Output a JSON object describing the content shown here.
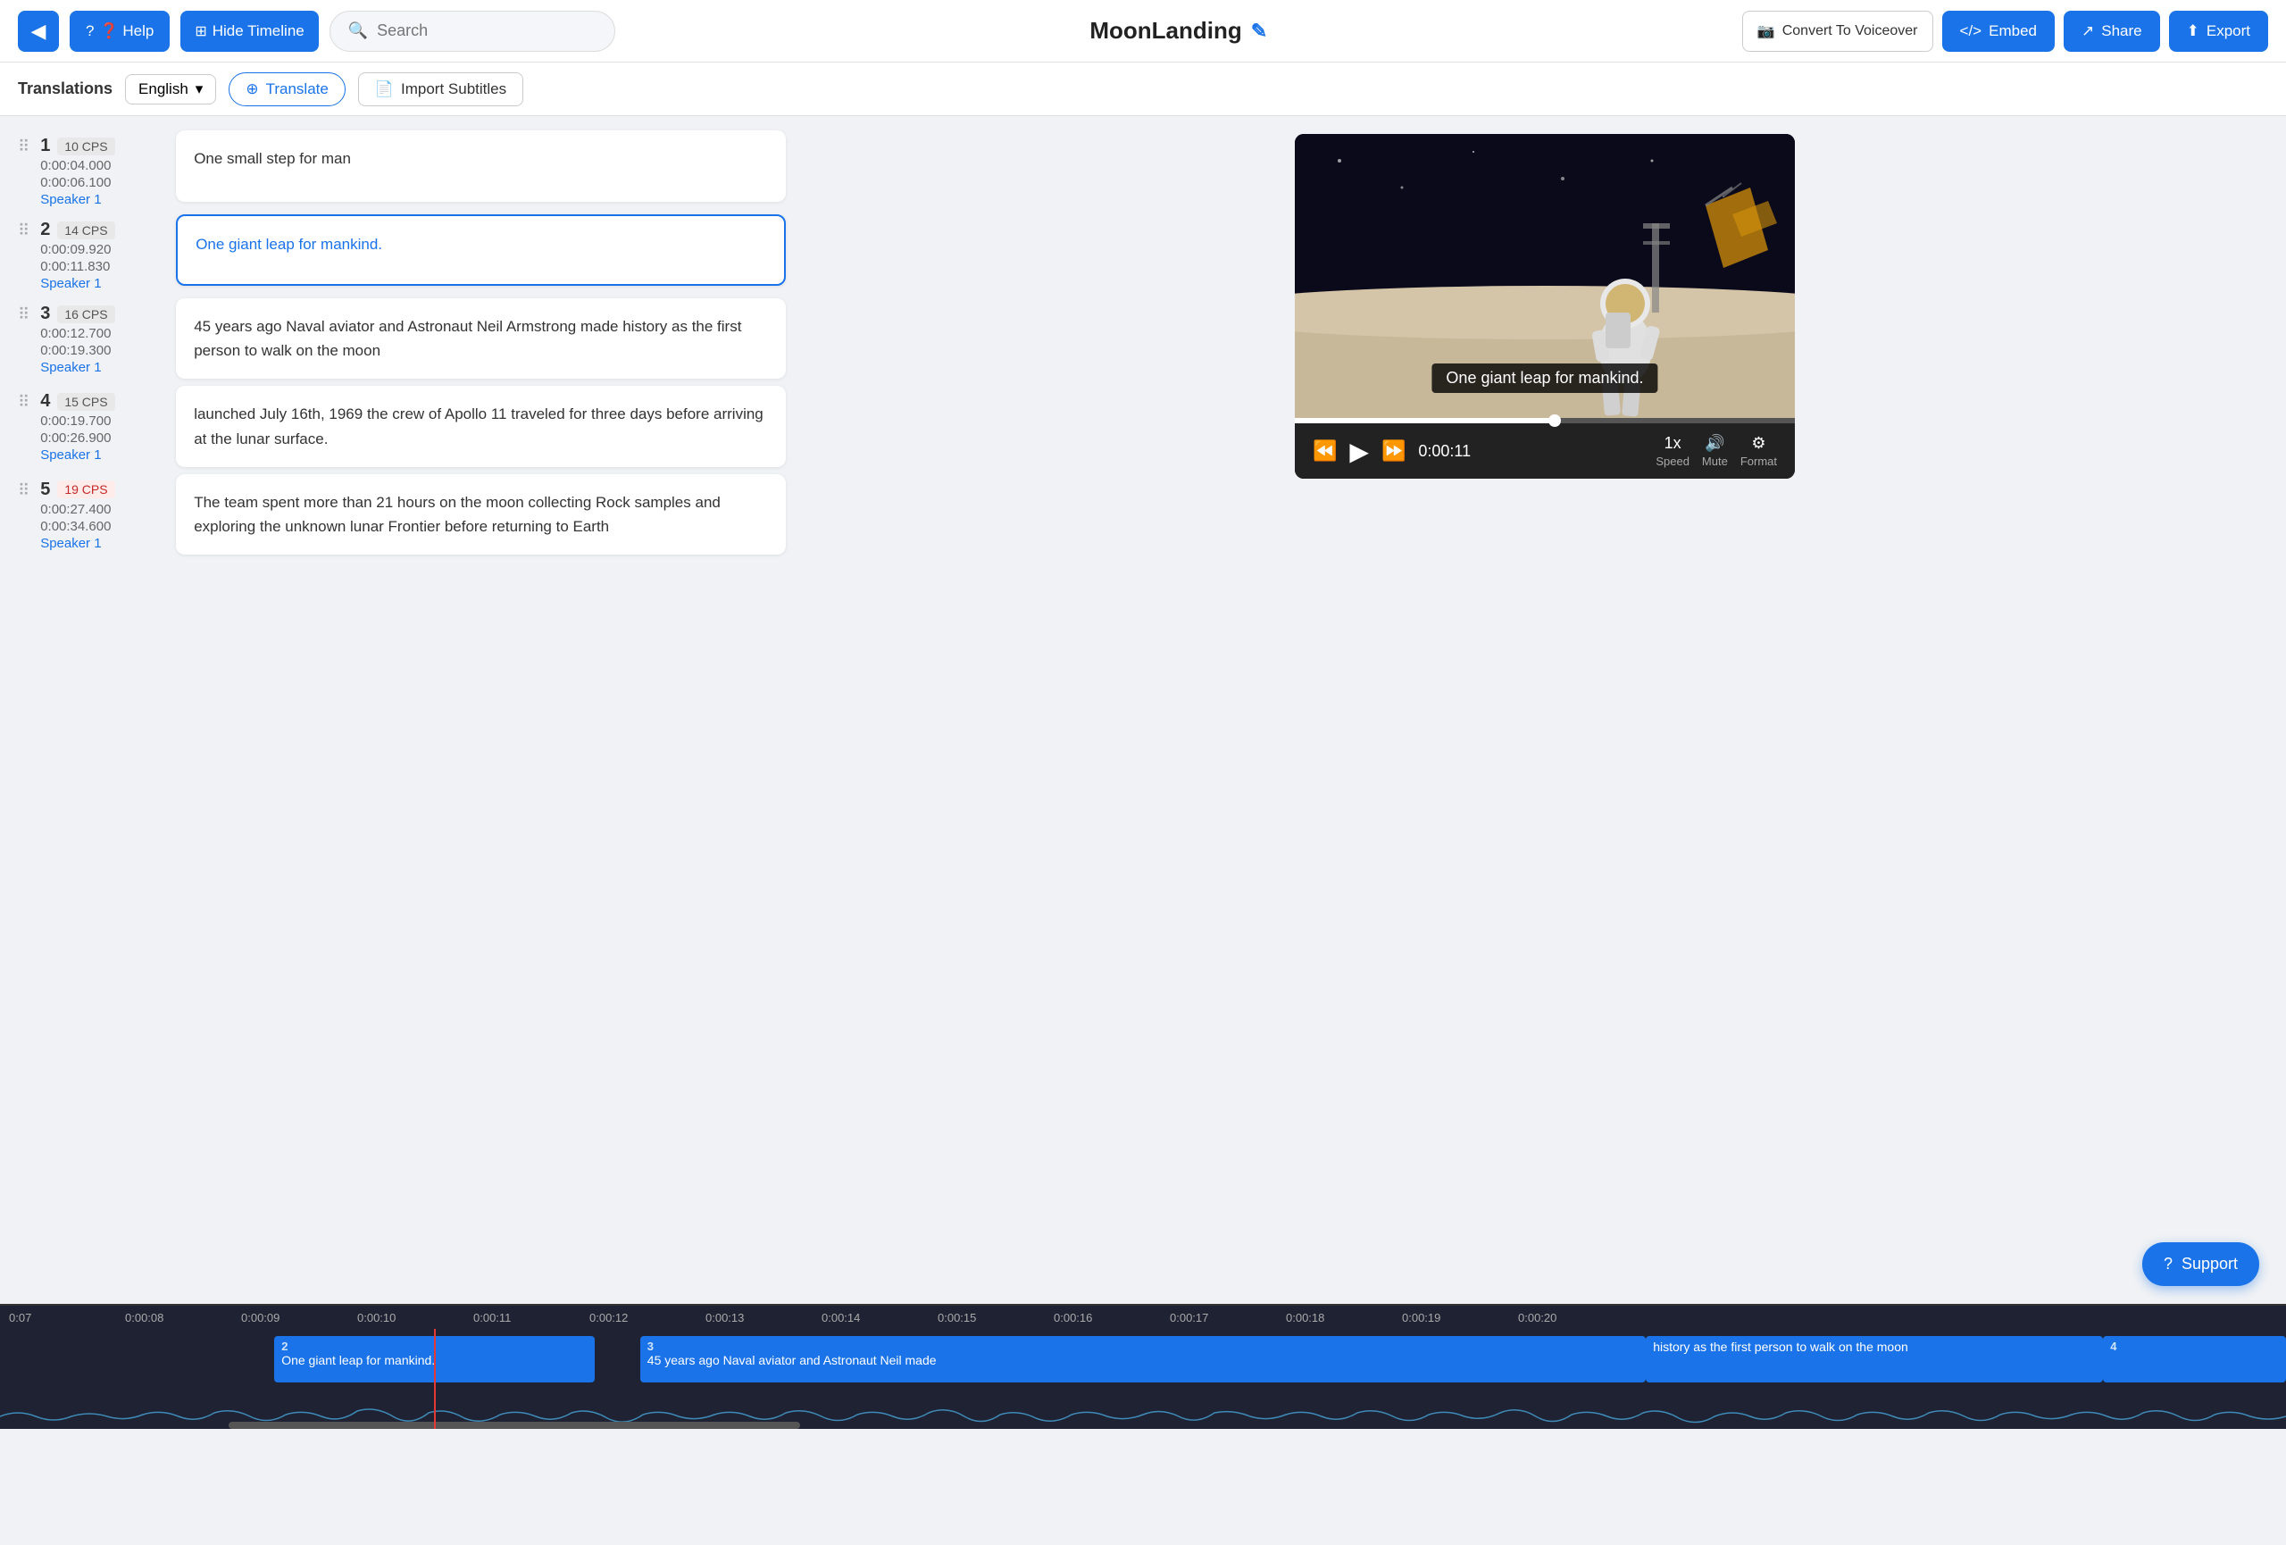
{
  "navbar": {
    "back_icon": "◀",
    "help_label": "❓ Help",
    "hide_timeline_label": "Hide Timeline",
    "search_placeholder": "Search",
    "title": "MoonLanding",
    "edit_icon": "✎",
    "convert_label": "Convert To Voiceover",
    "embed_label": "Embed",
    "share_label": "Share",
    "export_label": "Export"
  },
  "subtitle_toolbar": {
    "label": "Translations",
    "language": "English",
    "translate_label": "Translate",
    "import_label": "Import Subtitles"
  },
  "subtitles": [
    {
      "num": "1",
      "cps": "10 CPS",
      "cps_high": false,
      "time_start": "0:00:04.000",
      "time_end": "0:00:06.100",
      "speaker": "Speaker 1",
      "text": "One small step for man",
      "active": false
    },
    {
      "num": "2",
      "cps": "14 CPS",
      "cps_high": false,
      "time_start": "0:00:09.920",
      "time_end": "0:00:11.830",
      "speaker": "Speaker 1",
      "text": "One giant leap for mankind.",
      "active": true
    },
    {
      "num": "3",
      "cps": "16 CPS",
      "cps_high": false,
      "time_start": "0:00:12.700",
      "time_end": "0:00:19.300",
      "speaker": "Speaker 1",
      "text": "45 years ago Naval aviator and Astronaut Neil Armstrong made history as the first person to walk on the moon",
      "active": false
    },
    {
      "num": "4",
      "cps": "15 CPS",
      "cps_high": false,
      "time_start": "0:00:19.700",
      "time_end": "0:00:26.900",
      "speaker": "Speaker 1",
      "text": "launched July 16th, 1969 the crew of Apollo 11 traveled for three days before arriving at the lunar surface.",
      "active": false
    },
    {
      "num": "5",
      "cps": "19 CPS",
      "cps_high": true,
      "time_start": "0:00:27.400",
      "time_end": "0:00:34.600",
      "speaker": "Speaker 1",
      "text": "The team spent more than 21 hours on the moon collecting Rock samples and exploring the unknown lunar Frontier before returning to Earth",
      "active": false
    }
  ],
  "video": {
    "subtitle_overlay": "One giant leap for mankind.",
    "time_display": "0:00:11",
    "speed_label": "Speed",
    "speed_value": "1x",
    "mute_label": "Mute",
    "format_label": "Format"
  },
  "timeline": {
    "ruler_ticks": [
      "0:07",
      "0:00:08",
      "0:00:09",
      "0:00:10",
      "0:00:11",
      "0:00:12",
      "0:00:13",
      "0:00:14",
      "0:00:15",
      "0:00:16",
      "0:00:17",
      "0:00:18",
      "0:00:19",
      "0:00:20"
    ],
    "segments": [
      {
        "id": "2",
        "label": "One giant leap for mankind.",
        "left_pct": 12,
        "width_pct": 14
      },
      {
        "id": "3",
        "label": "45 years ago Naval aviator and Astronaut Neil made",
        "left_pct": 28,
        "width_pct": 45
      },
      {
        "id": "4",
        "label": "history as the first person to walk on the moon",
        "left_pct": 73,
        "width_pct": 24
      }
    ],
    "playhead_pct": 19
  },
  "support": {
    "label": "Support"
  }
}
